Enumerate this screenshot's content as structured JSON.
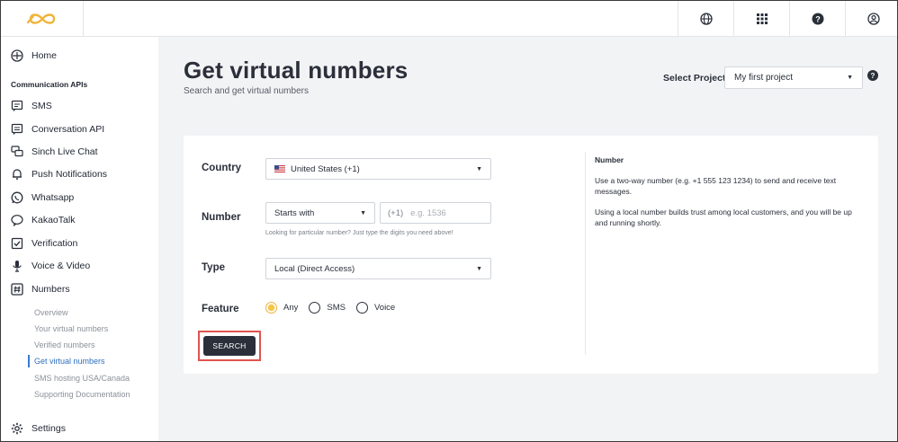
{
  "topbar": {
    "icons": [
      "sinch-logo-icon",
      "globe-icon",
      "apps-grid-icon",
      "help-icon",
      "account-icon"
    ]
  },
  "sidebar": {
    "home": "Home",
    "section_title": "Communication APIs",
    "items": [
      {
        "label": "SMS",
        "icon": "message-icon"
      },
      {
        "label": "Conversation API",
        "icon": "conversation-icon"
      },
      {
        "label": "Sinch Live Chat",
        "icon": "chat-icon"
      },
      {
        "label": "Push Notifications",
        "icon": "bell-icon"
      },
      {
        "label": "Whatsapp",
        "icon": "whatsapp-icon"
      },
      {
        "label": "KakaoTalk",
        "icon": "kakaotalk-icon"
      },
      {
        "label": "Verification",
        "icon": "check-box-icon"
      },
      {
        "label": "Voice & Video",
        "icon": "microphone-icon"
      },
      {
        "label": "Numbers",
        "icon": "hash-icon"
      }
    ],
    "sub_items": [
      {
        "label": "Overview"
      },
      {
        "label": "Your virtual numbers"
      },
      {
        "label": "Verified numbers"
      },
      {
        "label": "Get virtual numbers",
        "active": true
      },
      {
        "label": "SMS hosting USA/Canada"
      },
      {
        "label": "Supporting Documentation"
      }
    ],
    "settings": "Settings"
  },
  "header": {
    "title": "Get virtual numbers",
    "subtitle": "Search and get virtual numbers",
    "project_label": "Select Project",
    "project_value": "My first project"
  },
  "form": {
    "country_label": "Country",
    "country_value": "United States (+1)",
    "number_label": "Number",
    "number_mode": "Starts with",
    "number_prefix": "(+1)",
    "number_placeholder": "e.g. 1536",
    "number_hint": "Looking for particular number? Just type the digits you need above!",
    "type_label": "Type",
    "type_value": "Local (Direct Access)",
    "feature_label": "Feature",
    "feature_options": [
      {
        "label": "Any",
        "selected": true
      },
      {
        "label": "SMS",
        "selected": false
      },
      {
        "label": "Voice",
        "selected": false
      }
    ],
    "search_button": "SEARCH"
  },
  "info": {
    "title": "Number",
    "para1": "Use a two-way number (e.g. +1 555 123 1234) to send and receive text messages.",
    "para2": "Using a local number builds trust among local customers, and you will be up and running shortly."
  },
  "colors": {
    "accent": "#f3c64a",
    "dark": "#2a2f3a",
    "highlight_border": "#e0534f",
    "active_link": "#2f6fbf"
  }
}
